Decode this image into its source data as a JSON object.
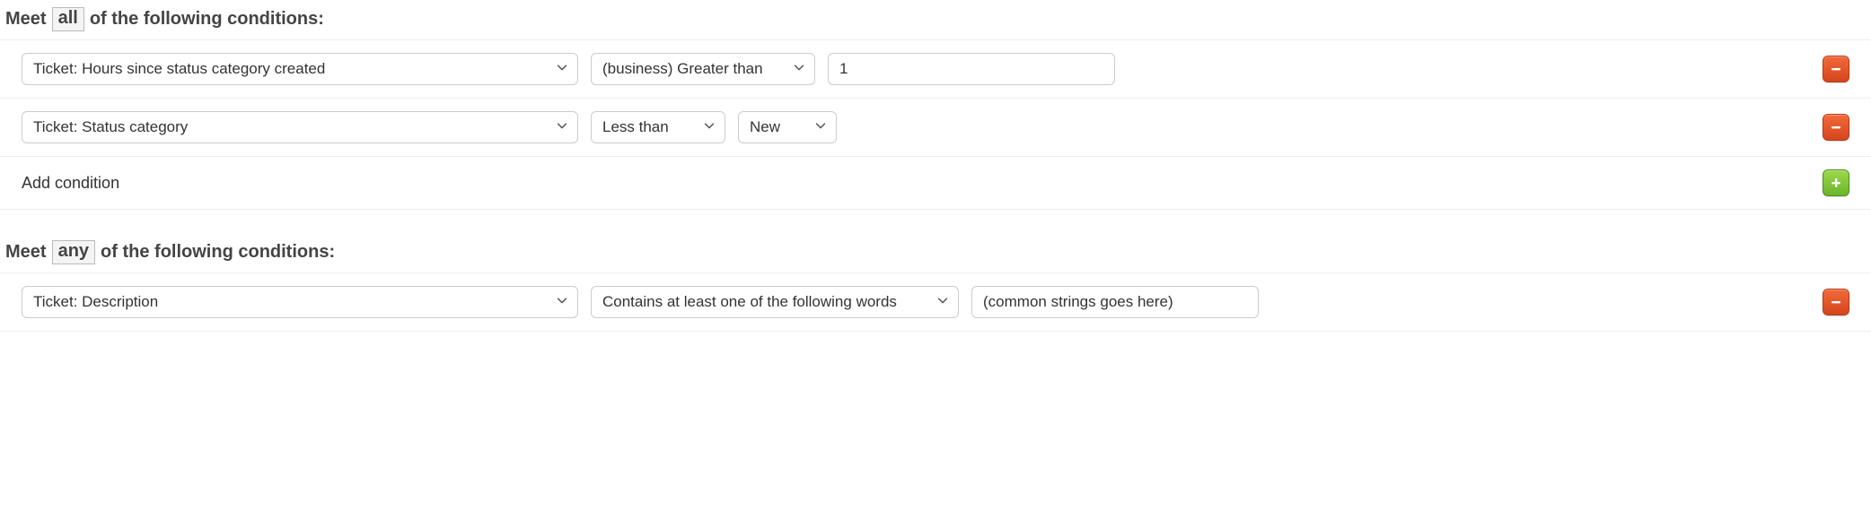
{
  "sections": {
    "all": {
      "header_pre": "Meet",
      "quantifier": "all",
      "header_post": "of the following conditions:",
      "conditions": [
        {
          "field": "Ticket: Hours since status category created",
          "operator": "(business) Greater than",
          "value": "1",
          "value_type": "text",
          "operator_width": 250,
          "extra_select": null
        },
        {
          "field": "Ticket: Status category",
          "operator": "Less than",
          "value": null,
          "value_type": null,
          "operator_width": 150,
          "extra_select": {
            "value": "New",
            "width": 110
          }
        }
      ],
      "add_label": "Add condition"
    },
    "any": {
      "header_pre": "Meet",
      "quantifier": "any",
      "header_post": "of the following conditions:",
      "conditions": [
        {
          "field": "Ticket: Description",
          "operator": "Contains at least one of the following words",
          "value": "(common strings goes here)",
          "value_type": "text",
          "operator_width": 410,
          "extra_select": null
        }
      ]
    }
  }
}
